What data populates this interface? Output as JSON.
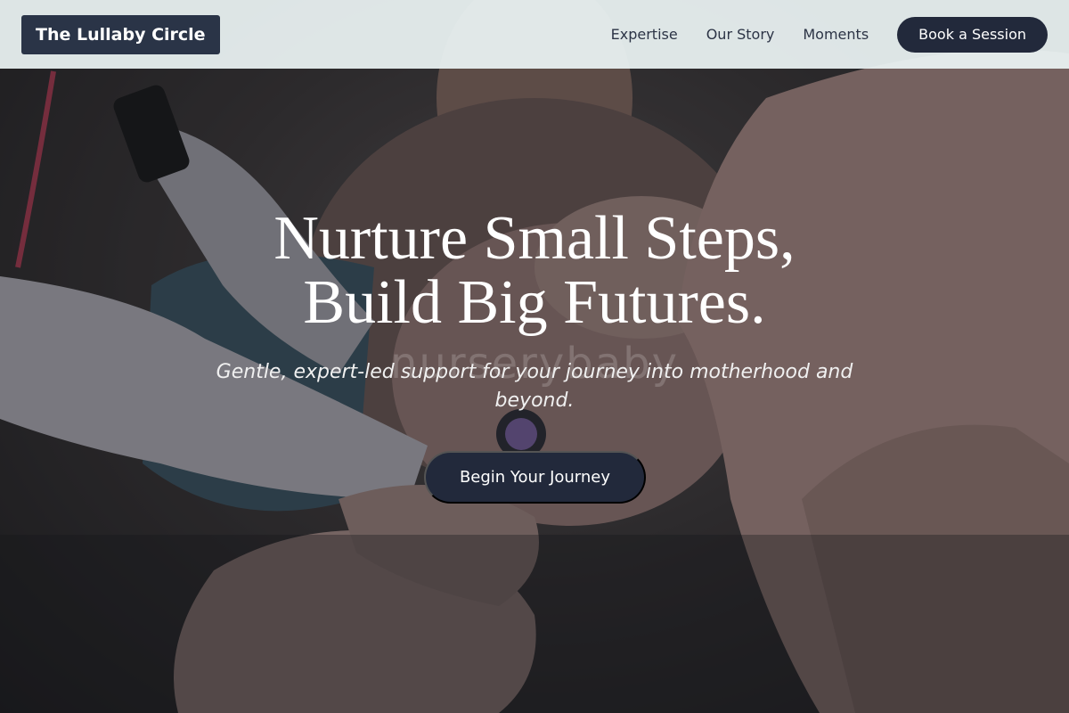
{
  "brand": {
    "name": "The Lullaby Circle"
  },
  "nav": {
    "items": [
      {
        "label": "Expertise"
      },
      {
        "label": "Our Story"
      },
      {
        "label": "Moments"
      }
    ],
    "book_label": "Book a Session"
  },
  "hero": {
    "headline_line1": "Nurture Small Steps,",
    "headline_line2": "Build Big Futures.",
    "subtitle": "Gentle, expert-led support for your journey into motherhood and beyond.",
    "cta_label": "Begin Your Journey",
    "watermark": "nurserybaby"
  },
  "colors": {
    "header_bg": "#ecf4f4",
    "brand_bg": "#2a3447",
    "button_bg": "#22293b",
    "text_light": "#ffffff"
  }
}
